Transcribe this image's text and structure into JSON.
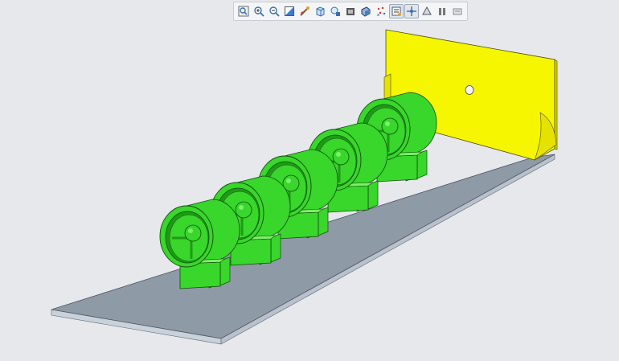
{
  "toolbar": {
    "buttons": [
      {
        "name": "refit-icon"
      },
      {
        "name": "zoom-in-icon"
      },
      {
        "name": "zoom-out-icon"
      },
      {
        "name": "repaint-icon"
      },
      {
        "name": "reorient-icon"
      },
      {
        "name": "display-style-icon"
      },
      {
        "name": "saved-orientations-icon"
      },
      {
        "name": "view-manager-icon"
      },
      {
        "name": "perspective-icon"
      },
      {
        "name": "datum-display-icon"
      },
      {
        "name": "annotation-display-icon"
      },
      {
        "name": "spin-center-icon"
      },
      {
        "name": "model-tree-icon"
      },
      {
        "name": "pause-icon"
      },
      {
        "name": "simplified-rep-icon"
      }
    ],
    "active_buttons": [
      "annotation-display-icon",
      "spin-center-icon"
    ]
  },
  "model": {
    "colors": {
      "background": "#e6e8ec",
      "base_plate_top": "#8f9aa7",
      "base_plate_edge": "#c9d1da",
      "back_wall": "#f6f600",
      "back_wall_shade": "#d8d400",
      "fan_green": "#39d62b",
      "fan_green_dark": "#1f9a17",
      "fan_green_light": "#7df06a"
    },
    "fan_count": 5
  }
}
